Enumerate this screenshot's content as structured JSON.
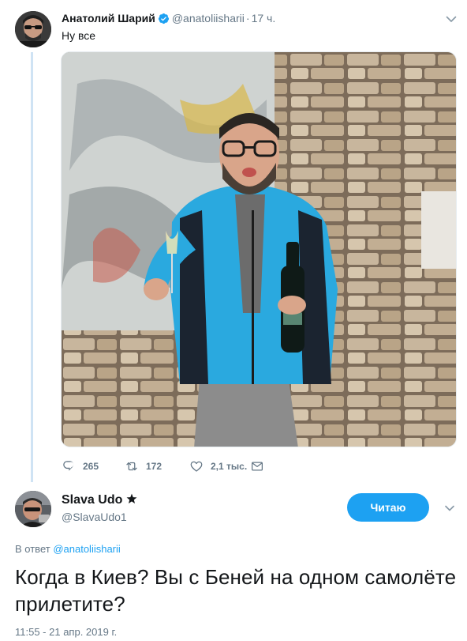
{
  "parent_tweet": {
    "author_name": "Анатолий Шарий",
    "handle": "@anatoliisharii",
    "separator": "·",
    "time": "17 ч.",
    "text": "Ну все",
    "actions": {
      "replies": "265",
      "retweets": "172",
      "likes": "2,1 тыс."
    }
  },
  "reply_tweet": {
    "author_name": "Slava Udo",
    "handle": "@SlavaUdo1",
    "follow_label": "Читаю",
    "in_reply_prefix": "В ответ",
    "in_reply_handle": "@anatoliisharii",
    "text": "Когда в Киев? Вы с Беней на одном самолёте прилетите?",
    "timestamp": "11:55 - 21 апр. 2019 г."
  },
  "colors": {
    "accent": "#1da1f2",
    "muted_text": "#657786",
    "thread_line": "#cfe3f4"
  }
}
